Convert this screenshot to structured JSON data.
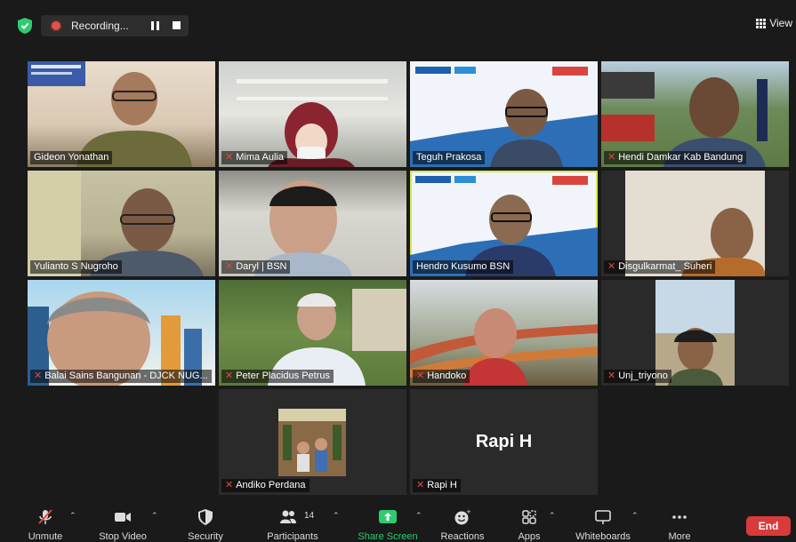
{
  "recording": {
    "label": "Recording..."
  },
  "view": {
    "label": "View"
  },
  "participants": [
    {
      "name": "Gideon Yonathan",
      "muted": false
    },
    {
      "name": "Mima Aulia",
      "muted": true
    },
    {
      "name": "Teguh Prakosa",
      "muted": false
    },
    {
      "name": "Hendi Damkar Kab Bandung",
      "muted": true
    },
    {
      "name": "Yulianto S Nugroho",
      "muted": false
    },
    {
      "name": "Daryl | BSN",
      "muted": true
    },
    {
      "name": "Hendro Kusumo BSN",
      "muted": false,
      "active_speaker": true
    },
    {
      "name": "Disgulkarmat_ Suheri",
      "muted": true
    },
    {
      "name": "Balai Sains Bangunan - DJCK NUG...",
      "muted": true
    },
    {
      "name": "Peter Placidus Petrus",
      "muted": true
    },
    {
      "name": "Handoko",
      "muted": true
    },
    {
      "name": "Unj_triyono",
      "muted": true
    },
    {
      "name": "Andiko Perdana",
      "muted": true
    },
    {
      "name": "Rapi H",
      "muted": true,
      "display_text": "Rapi H",
      "video_off": true
    }
  ],
  "toolbar": {
    "unmute": "Unmute",
    "stop_video": "Stop Video",
    "security": "Security",
    "participants": "Participants",
    "participants_count": "14",
    "share_screen": "Share Screen",
    "reactions": "Reactions",
    "apps": "Apps",
    "whiteboards": "Whiteboards",
    "more": "More",
    "end": "End"
  },
  "colors": {
    "share_screen": "#2ecc71",
    "end": "#d93a3a",
    "active_speaker": "#d6e84a",
    "muted": "#e4463f"
  }
}
